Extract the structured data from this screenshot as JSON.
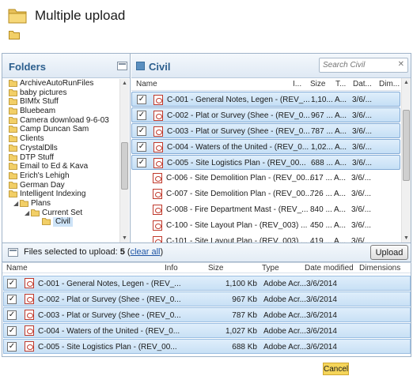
{
  "window": {
    "title": "Multiple upload",
    "icon": "folder-icon"
  },
  "folders": {
    "title": "Folders",
    "items": [
      {
        "label": "ArchiveAutoRunFiles",
        "depth": 0
      },
      {
        "label": "baby pictures",
        "depth": 0
      },
      {
        "label": "BIMfx Stuff",
        "depth": 0
      },
      {
        "label": "Bluebeam",
        "depth": 0
      },
      {
        "label": "Camera download 9-6-03",
        "depth": 0
      },
      {
        "label": "Camp Duncan  Sam",
        "depth": 0
      },
      {
        "label": "Clients",
        "depth": 0
      },
      {
        "label": "CrystalDlls",
        "depth": 0
      },
      {
        "label": "DTP Stuff",
        "depth": 0
      },
      {
        "label": "Email to Ed & Kava",
        "depth": 0
      },
      {
        "label": "Erich's Lehigh",
        "depth": 0
      },
      {
        "label": "German Day",
        "depth": 0
      },
      {
        "label": "Intelligent Indexing",
        "depth": 0
      },
      {
        "label": "Plans",
        "depth": 1,
        "expanded": true
      },
      {
        "label": "Current Set",
        "depth": 2,
        "expanded": true
      },
      {
        "label": "Civil",
        "depth": 3,
        "selected": true
      }
    ]
  },
  "files": {
    "title": "Civil",
    "search_placeholder": "Search Civil",
    "columns": {
      "name": "Name",
      "info": "I...",
      "size": "Size",
      "type": "T...",
      "date": "Dat...",
      "dims": "Dim..."
    },
    "rows": [
      {
        "name": "C-001 - General Notes, Legen - (REV_...",
        "size": "1,10...",
        "type": "A...",
        "date": "3/6/...",
        "checked": true
      },
      {
        "name": "C-002 - Plat or Survey (Shee - (REV_0...",
        "size": "967 ...",
        "type": "A...",
        "date": "3/6/...",
        "checked": true
      },
      {
        "name": "C-003 - Plat or Survey (Shee - (REV_0...",
        "size": "787 ...",
        "type": "A...",
        "date": "3/6/...",
        "checked": true
      },
      {
        "name": "C-004 - Waters of the United - (REV_0...",
        "size": "1,02...",
        "type": "A...",
        "date": "3/6/...",
        "checked": true
      },
      {
        "name": "C-005 - Site Logistics Plan  - (REV_00...",
        "size": "688 ...",
        "type": "A...",
        "date": "3/6/...",
        "checked": true
      },
      {
        "name": "C-006 - Site Demolition Plan - (REV_00...",
        "size": "617 ...",
        "type": "A...",
        "date": "3/6/...",
        "checked": false
      },
      {
        "name": "C-007 - Site Demolition Plan - (REV_00...",
        "size": "726 ...",
        "type": "A...",
        "date": "3/6/...",
        "checked": false
      },
      {
        "name": "C-008 - Fire Department Mast - (REV_...",
        "size": "840 ...",
        "type": "A...",
        "date": "3/6/...",
        "checked": false
      },
      {
        "name": "C-100 - Site Layout Plan - (REV_003) ...",
        "size": "450 ...",
        "type": "A...",
        "date": "3/6/...",
        "checked": false
      },
      {
        "name": "C-101 - Site Layout Plan - (REV_003) ...",
        "size": "419 ...",
        "type": "A...",
        "date": "3/6/...",
        "checked": false
      }
    ]
  },
  "selection": {
    "label_prefix": "Files selected to upload:",
    "count": "5",
    "clear_link": "clear all",
    "upload_label": "Upload"
  },
  "upload_table": {
    "columns": {
      "name": "Name",
      "info": "Info",
      "size": "Size",
      "type": "Type",
      "date": "Date modified",
      "dims": "Dimensions"
    },
    "rows": [
      {
        "name": "C-001 - General Notes, Legen - (REV_...",
        "size": "1,100 Kb",
        "type": "Adobe Acr...",
        "date": "3/6/2014"
      },
      {
        "name": "C-002 - Plat or Survey (Shee - (REV_0...",
        "size": "967 Kb",
        "type": "Adobe Acr...",
        "date": "3/6/2014"
      },
      {
        "name": "C-003 - Plat or Survey (Shee - (REV_0...",
        "size": "787 Kb",
        "type": "Adobe Acr...",
        "date": "3/6/2014"
      },
      {
        "name": "C-004 - Waters of the United - (REV_0...",
        "size": "1,027 Kb",
        "type": "Adobe Acr...",
        "date": "3/6/2014"
      },
      {
        "name": "C-005 - Site Logistics Plan  - (REV_00...",
        "size": "688 Kb",
        "type": "Adobe Acr...",
        "date": "3/6/2014"
      }
    ]
  },
  "footer": {
    "cancel_label": "Cancel"
  },
  "colors": {
    "accent": "#2c5f8e",
    "selection": "#c5dff5",
    "cancel_bg": "#f5d55a",
    "link": "#1f56a6"
  }
}
